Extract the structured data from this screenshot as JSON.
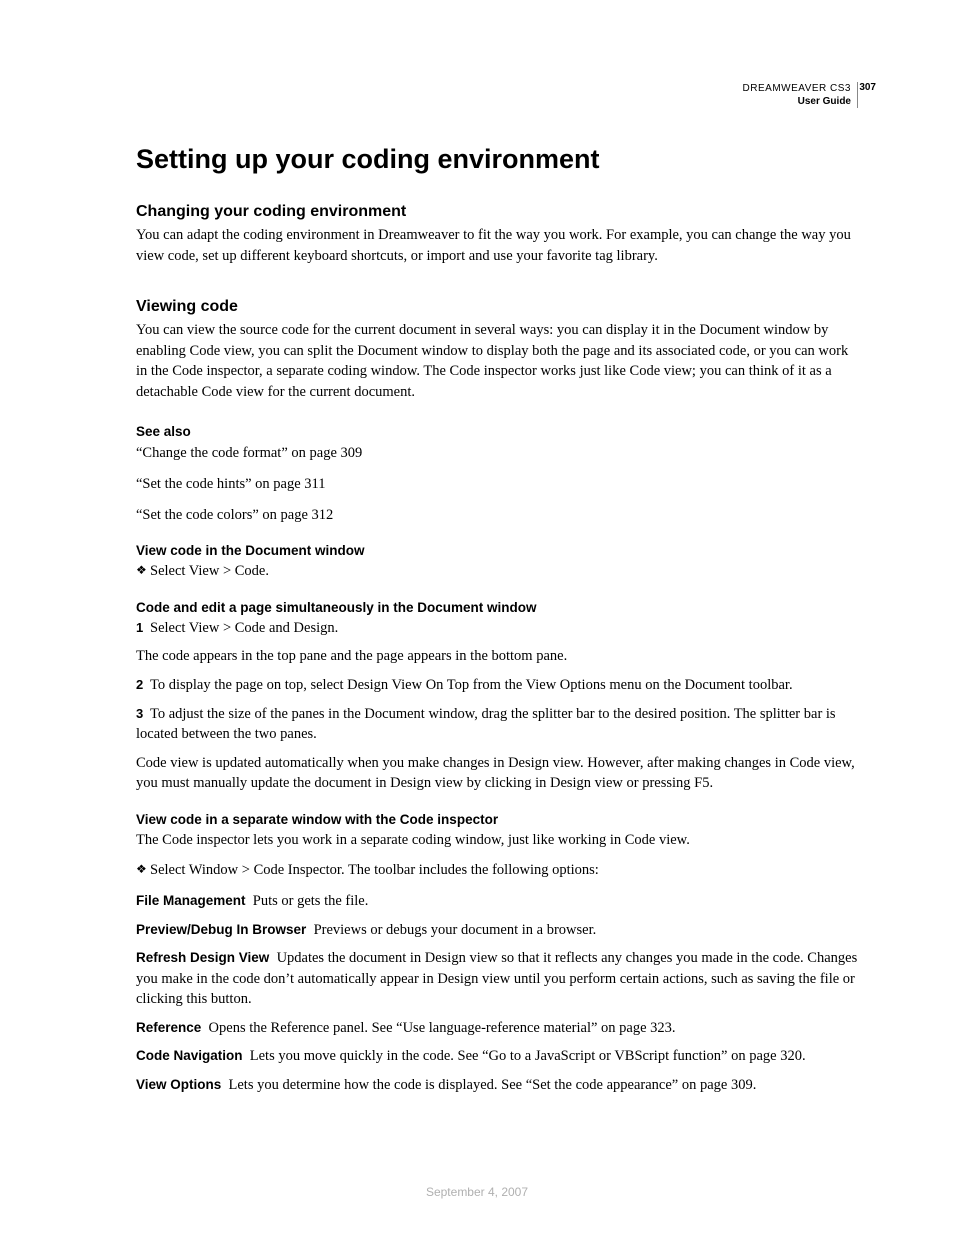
{
  "header": {
    "product": "DREAMWEAVER CS3",
    "guide": "User Guide",
    "page_number": "307"
  },
  "footer": {
    "date": "September 4, 2007"
  },
  "title": "Setting up your coding environment",
  "sections": {
    "changing": {
      "heading": "Changing your coding environment",
      "body": "You can adapt the coding environment in Dreamweaver to fit the way you work. For example, you can change the way you view code, set up different keyboard shortcuts, or import and use your favorite tag library."
    },
    "viewing": {
      "heading": "Viewing code",
      "body": "You can view the source code for the current document in several ways: you can display it in the Document window by enabling Code view, you can split the Document window to display both the page and its associated code, or you can work in the Code inspector, a separate coding window. The Code inspector works just like Code view; you can think of it as a detachable Code view for the current document."
    },
    "see_also": {
      "heading": "See also",
      "items": [
        "“Change the code format” on page 309",
        "“Set the code hints” on page 311",
        "“Set the code colors” on page 312"
      ]
    },
    "sub1": {
      "heading": "View code in the Document window",
      "bullet": "Select View > Code."
    },
    "sub2": {
      "heading": "Code and edit a page simultaneously in the Document window",
      "step1": "Select View > Code and Design.",
      "after1": "The code appears in the top pane and the page appears in the bottom pane.",
      "step2": "To display the page on top, select Design View On Top from the View Options menu on the Document toolbar.",
      "step3": "To adjust the size of the panes in the Document window, drag the splitter bar to the desired position. The splitter bar is located between the two panes.",
      "after3": "Code view is updated automatically when you make changes in Design view. However, after making changes in Code view, you must manually update the document in Design view by clicking in Design view or pressing F5."
    },
    "sub3": {
      "heading": "View code in a separate window with the Code inspector",
      "intro": "The Code inspector lets you work in a separate coding window, just like working in Code view.",
      "bullet": "Select Window > Code Inspector. The toolbar includes the following options:",
      "defs": {
        "file_management": {
          "term": "File Management",
          "desc": "Puts or gets the file."
        },
        "preview": {
          "term": "Preview/Debug In Browser",
          "desc": "Previews or debugs your document in a browser."
        },
        "refresh": {
          "term": "Refresh Design View",
          "desc": "Updates the document in Design view so that it reflects any changes you made in the code. Changes you make in the code don’t automatically appear in Design view until you perform certain actions, such as saving the file or clicking this button."
        },
        "reference": {
          "term": "Reference",
          "desc": "Opens the Reference panel. See “Use language-reference material” on page 323."
        },
        "code_nav": {
          "term": "Code Navigation",
          "desc": "Lets you move quickly in the code. See “Go to a JavaScript or VBScript function” on page 320."
        },
        "view_options": {
          "term": "View Options",
          "desc": "Lets you determine how the code is displayed. See “Set the code appearance” on page 309."
        }
      }
    }
  }
}
